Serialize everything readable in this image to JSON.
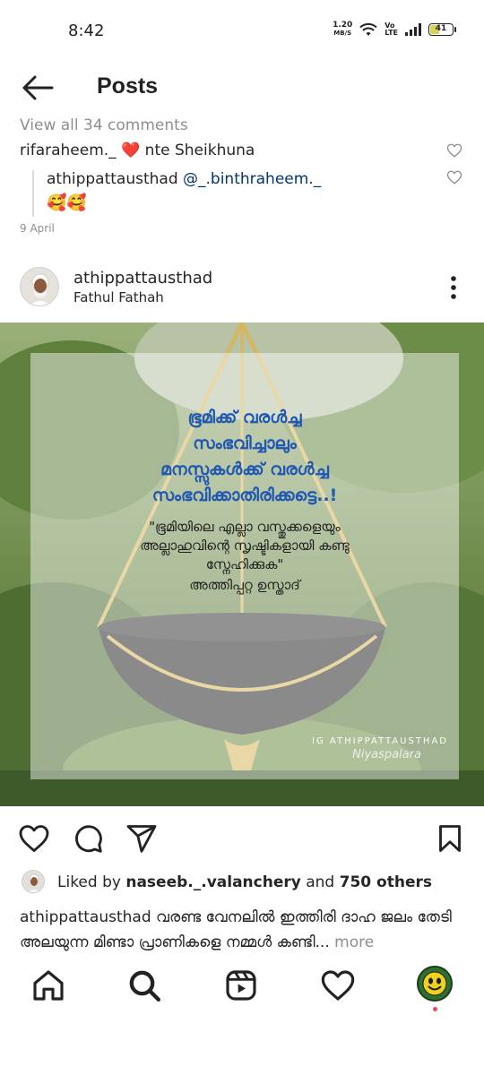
{
  "status_bar": {
    "time": "8:42",
    "net_speed_value": "1.20",
    "net_speed_unit": "MB/S",
    "volte_top": "Vo",
    "volte_bottom": "LTE",
    "battery": "41"
  },
  "header": {
    "title": "Posts"
  },
  "comments": {
    "view_all": "View all 34 comments",
    "items": [
      {
        "user": "rifaraheem._",
        "emoji": "❤️",
        "text": "nte Sheikhuna"
      },
      {
        "user": "athippattausthad",
        "mention": "@_.binthraheem._",
        "emoji": "🥰🥰"
      }
    ],
    "date": "9 April"
  },
  "post": {
    "username": "athippattausthad",
    "location": "Fathul Fathah",
    "image": {
      "quote_lines": [
        "ഭൂമിക്ക് വരൾച്ച",
        "സംഭവിച്ചാലും",
        "മനസ്സുകൾക്ക് വരൾച്ച",
        "സംഭവിക്കാതിരിക്കട്ടെ..!"
      ],
      "sub_lines": [
        "\"ഭൂമിയിലെ എല്ലാ വസ്തുക്കളെയും",
        "അല്ലാഹുവിന്റെ സൃഷ്ടികളായി കണ്ടു",
        "സ്നേഹിക്കുക\""
      ],
      "author": "അത്തിപ്പറ്റ ഉസ്താദ്",
      "ig_tag": "IG ATHIPPATTAUSTHAD",
      "signature": "Niyaspalara"
    },
    "likes": {
      "prefix": "Liked by",
      "user": "naseeb._.valanchery",
      "and": "and",
      "others": "750 others"
    },
    "caption": {
      "user": "athippattausthad",
      "text": "വരണ്ട വേനലിൽ ഇത്തിരി ദാഹ ജലം തേടി അലയുന്ന മിണ്ടാ പ്രാണികളെ നമ്മൾ കണ്ടി...",
      "more": "more"
    }
  },
  "colors": {
    "quote_blue": "#1f57b3",
    "heart_red": "#ed4956",
    "link_blue": "#00376b"
  },
  "icons": {
    "back": "arrow-left-icon",
    "more": "more-vertical-icon",
    "like": "heart-icon",
    "comment": "comment-icon",
    "share": "send-icon",
    "save": "bookmark-icon",
    "home": "home-icon",
    "search": "search-icon",
    "reels": "reels-icon",
    "activity": "heart-icon"
  }
}
